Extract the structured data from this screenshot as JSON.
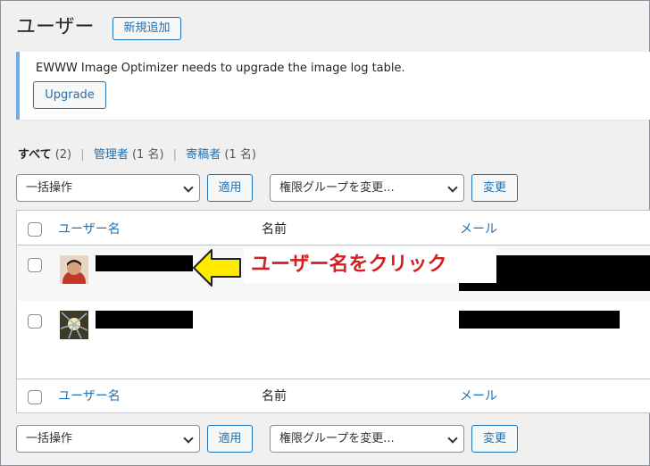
{
  "header": {
    "title": "ユーザー",
    "add_new_label": "新規追加"
  },
  "notice": {
    "text": "EWWW Image Optimizer needs to upgrade the image log table.",
    "button_label": "Upgrade"
  },
  "filters": {
    "all_label": "すべて",
    "all_count": "(2)",
    "admin_label": "管理者",
    "admin_count": "(1 名)",
    "contributor_label": "寄稿者",
    "contributor_count": "(1 名)",
    "separator": "|"
  },
  "bulk_top": {
    "bulk_action": "一括操作",
    "apply_label": "適用",
    "role_change": "権限グループを変更...",
    "change_label": "変更"
  },
  "bulk_bottom": {
    "bulk_action": "一括操作",
    "apply_label": "適用",
    "role_change": "権限グループを変更...",
    "change_label": "変更"
  },
  "table": {
    "columns": {
      "username": "ユーザー名",
      "name": "名前",
      "email": "メール"
    }
  },
  "annotation": {
    "text": "ユーザー名をクリック"
  },
  "colors": {
    "accent": "#2271b1",
    "notice_border": "#72aee6",
    "callout_text": "#d32020",
    "arrow_fill": "#ffeb00"
  }
}
